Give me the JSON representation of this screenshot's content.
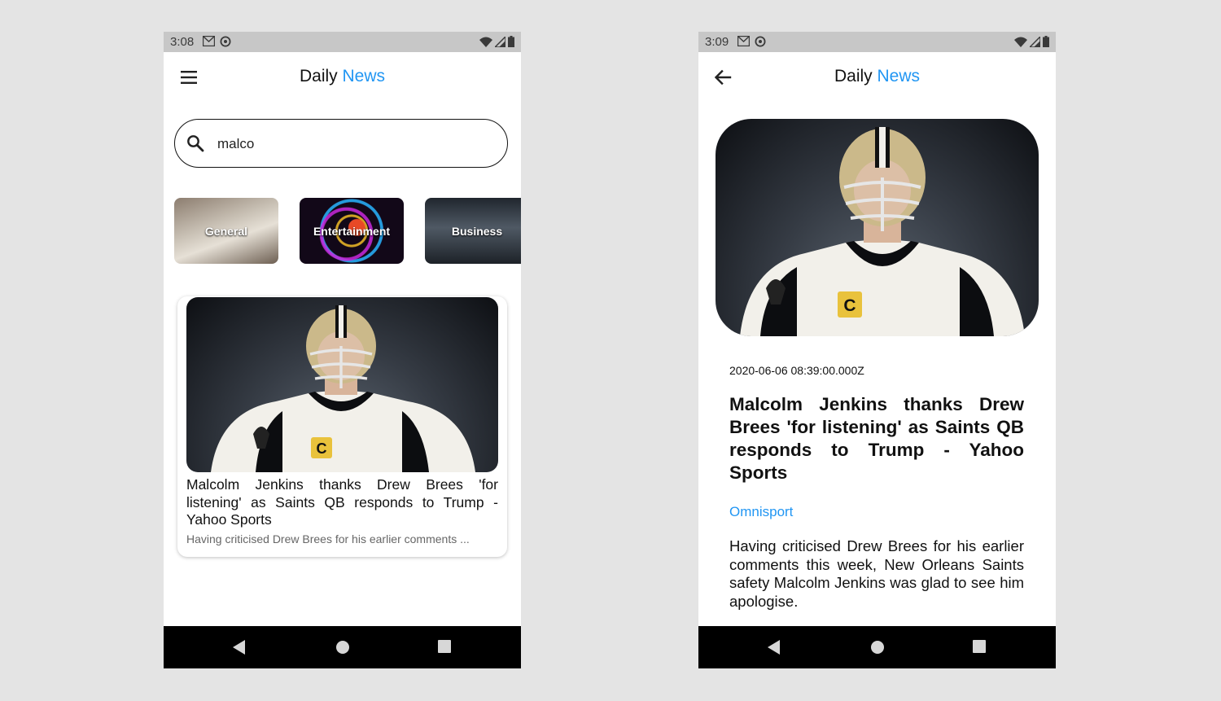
{
  "left_screen": {
    "status": {
      "time": "3:08"
    },
    "appbar": {
      "title_part1": "Daily ",
      "title_part2": "News"
    },
    "search": {
      "value": "malco"
    },
    "categories": [
      "General",
      "Entertainment",
      "Business"
    ],
    "article": {
      "title": "Malcolm Jenkins thanks Drew Brees 'for listening' as Saints QB responds to Trump - Yahoo Sports",
      "description": "Having criticised Drew Brees for his earlier comments ..."
    }
  },
  "right_screen": {
    "status": {
      "time": "3:09"
    },
    "appbar": {
      "title_part1": "Daily ",
      "title_part2": "News"
    },
    "article": {
      "published_at": "2020-06-06 08:39:00.000Z",
      "title": "Malcolm Jenkins thanks Drew Brees 'for listening' as Saints QB responds to Trump - Yahoo Sports",
      "source": "Omnisport",
      "description": "Having criticised Drew Brees for his earlier comments this week, New Orleans Saints safety Malcolm Jenkins was glad to see him apologise."
    }
  },
  "colors": {
    "accent": "#2196f3",
    "statusbar": "#c7c7c7",
    "navbar": "#000000"
  },
  "icons": [
    "menu-icon",
    "back-arrow-icon",
    "search-icon",
    "gmail-icon",
    "sync-icon",
    "wifi-icon",
    "signal-icon",
    "battery-icon",
    "nav-back-icon",
    "nav-home-icon",
    "nav-recents-icon"
  ]
}
